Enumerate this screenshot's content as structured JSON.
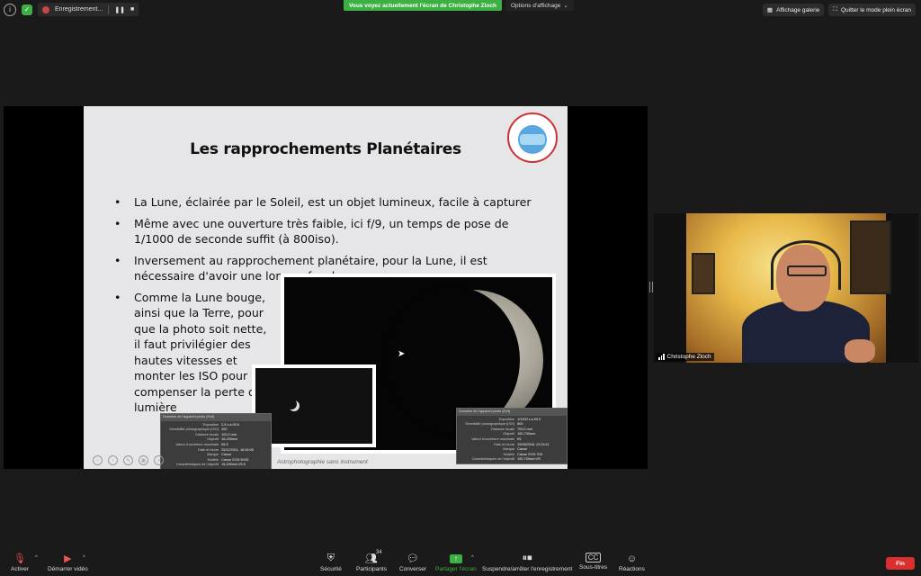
{
  "topbar": {
    "recording_label": "Enregistrement...",
    "viewing_banner": "Vous voyez actuellement l'écran de Christophe Zloch",
    "view_options": "Options d'affichage",
    "gallery_view": "Affichage galerie",
    "exit_fullscreen": "Quitter le mode plein écran"
  },
  "slide": {
    "title": "Les rapprochements Planétaires",
    "bullets": [
      "La Lune, éclairée par le Soleil, est un objet lumineux, facile à capturer",
      "Même avec une ouverture très faible, ici f/9, un temps de pose de 1/1000 de seconde suffit (à 800iso).",
      "Inversement au rapprochement planétaire, pour la Lune, il est nécessaire d'avoir une longue focale.",
      "Comme la Lune bouge, ainsi que la Terre, pour que la photo soit nette, il faut privilégier des hautes vitesses et monter les ISO pour compenser la perte de lumière"
    ],
    "caption": "Astrophotographie sans instrument",
    "logo_text": "CLUB D'ASTRONOMIE D'ANTONY",
    "exif_left": {
      "header": "Données de l'appareil photo (Exif)",
      "rows": [
        {
          "k": "Exposition",
          "v": "2,5 s à f/5.6"
        },
        {
          "k": "Sensibilité photographique (ISO)",
          "v": "400"
        },
        {
          "k": "Distance focale",
          "v": "100,0 mm"
        },
        {
          "k": "Objectif",
          "v": "18-200mm"
        },
        {
          "k": "Valeur d'ouverture maximale",
          "v": "f/6.3"
        },
        {
          "k": "Date et heure",
          "v": "25/12/2011, 18:26:08"
        },
        {
          "k": "Marque",
          "v": "Canon"
        },
        {
          "k": "Modèle",
          "v": "Canon EOS 500D"
        },
        {
          "k": "Caractéristiques de l'objectif",
          "v": "18-200mm f/3.5"
        }
      ]
    },
    "exif_right": {
      "header": "Données de l'appareil photo (Exif)",
      "rows": [
        {
          "k": "Exposition",
          "v": "1/1000 s à f/9.0"
        },
        {
          "k": "Sensibilité photographique (ISO)",
          "v": "800"
        },
        {
          "k": "Distance focale",
          "v": "700,0 mm"
        },
        {
          "k": "Objectif",
          "v": "150-700mm"
        },
        {
          "k": "Valeur d'ouverture maximale",
          "v": "f/6"
        },
        {
          "k": "Date et heure",
          "v": "15/08/2016, 22:04:11"
        },
        {
          "k": "Marque",
          "v": "Canon"
        },
        {
          "k": "Modèle",
          "v": "Canon EOS 70D"
        },
        {
          "k": "Caractéristiques de l'objectif",
          "v": "150-700mm f/5"
        }
      ]
    }
  },
  "video": {
    "participant_name": "Christophe Zloch"
  },
  "toolbar": {
    "mute_label": "Activer",
    "video_label": "Démarrer vidéo",
    "security_label": "Sécurité",
    "participants_label": "Participants",
    "participants_count": "34",
    "chat_label": "Converser",
    "share_label": "Partager l'écran",
    "pause_label": "Suspendre/arrêter l'enregistrement",
    "captions_label": "Sous-titres",
    "reactions_label": "Réactions",
    "end_label": "Fin"
  }
}
